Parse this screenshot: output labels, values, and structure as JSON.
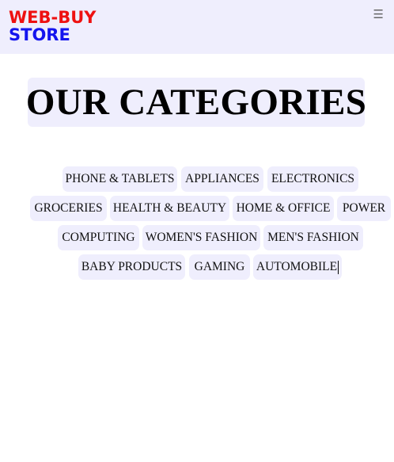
{
  "header": {
    "logo_line1": "WEB-BUY",
    "logo_line2": "STORE",
    "menu_icon": "hamburger-icon",
    "menu_glyph": "☰"
  },
  "main": {
    "title": "OUR CATEGORIES"
  },
  "categories": [
    "PHONE & TABLETS",
    "APPLIANCES",
    "ELECTRONICS",
    "GROCERIES",
    "HEALTH & BEAUTY",
    "HOME & OFFICE",
    "POWER",
    "COMPUTING",
    "WOMEN'S FASHION",
    "MEN'S FASHION",
    "BABY PRODUCTS",
    "GAMING",
    "AUTOMOBILE"
  ],
  "colors": {
    "logo_red": "#ee1111",
    "logo_blue": "#1414ee",
    "header_bg": "#efeefd",
    "chip_bg": "#efeefd"
  }
}
